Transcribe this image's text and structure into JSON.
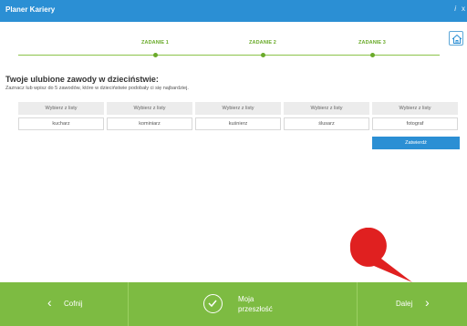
{
  "window": {
    "title": "Planer Kariery",
    "info_icon": "info-icon",
    "close_icon": "close-icon"
  },
  "toolbar": {
    "home_icon": "home-icon"
  },
  "steps": [
    {
      "label": "ZADANIE 1"
    },
    {
      "label": "ZADANIE 2"
    },
    {
      "label": "ZADANIE 3"
    }
  ],
  "section": {
    "title": "Twoje ulubione zawody w dzieciństwie:",
    "instruction": "Zaznacz lub wpisz do 5 zawodów, które w dzieciństwie podobały ci się najbardziej."
  },
  "selects": [
    "Wybierz z listy",
    "Wybierz z listy",
    "Wybierz z listy",
    "Wybierz z listy",
    "Wybierz z listy"
  ],
  "inputs": [
    "kucharz",
    "kominiarz",
    "kuśnierz",
    "ślusarz",
    "fotograf"
  ],
  "confirm_label": "Zatwierdź",
  "footer": {
    "back_label": "Cofnij",
    "past_label_line1": "Moja",
    "past_label_line2": "przeszłość",
    "next_label": "Dalej"
  },
  "colors": {
    "accent_blue": "#2b8fd4",
    "footer_green": "#7dbb42",
    "step_green": "#6aaa2a",
    "pointer_red": "#e02020"
  }
}
